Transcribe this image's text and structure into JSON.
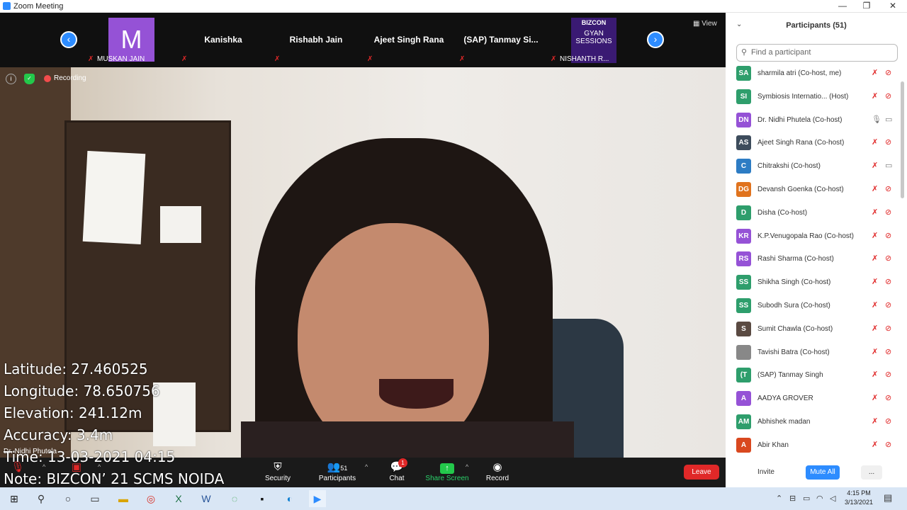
{
  "window": {
    "title": "Zoom Meeting"
  },
  "gallery": {
    "prev": "‹",
    "next": "›",
    "view": "View",
    "tiles": [
      {
        "name": "",
        "label": "MUSKAN JAIN",
        "avatar_letter": "M"
      },
      {
        "name": "Kanishka",
        "label": ""
      },
      {
        "name": "Rishabh Jain",
        "label": ""
      },
      {
        "name": "Ajeet Singh Rana",
        "label": ""
      },
      {
        "name": "(SAP) Tanmay Si...",
        "label": ""
      },
      {
        "name": "",
        "label": "NISHANTH R...",
        "bizcon_top": "BIZCON",
        "bizcon_sub": "GYAN SESSIONS"
      }
    ]
  },
  "video": {
    "recording": "Recording",
    "speaker": "Dr. Nidhi Phutela",
    "overlay": [
      "Latitude: 27.460525",
      "Longitude: 78.650756",
      "Elevation: 241.12m",
      "Accuracy: 3.4m",
      "Time: 13-03-2021  04:15",
      "Note: BIZCON’ 21 SCMS NOIDA"
    ]
  },
  "toolbar": {
    "security": "Security",
    "participants": "Participants",
    "participants_count": "51",
    "chat": "Chat",
    "chat_badge": "1",
    "share": "Share Screen",
    "record": "Record",
    "leave": "Leave"
  },
  "panel": {
    "title": "Participants (51)",
    "search_placeholder": "Find a participant",
    "invite": "Invite",
    "mute_all": "Mute All",
    "more": "...",
    "participants": [
      {
        "initials": "SA",
        "name": "sharmila atri (Co-host, me)",
        "color": "#2e9e6c",
        "mic": "off",
        "cam": "off"
      },
      {
        "initials": "SI",
        "name": "Symbiosis Internatio...  (Host)",
        "color": "#2e9e6c",
        "mic": "off",
        "cam": "off"
      },
      {
        "initials": "DN",
        "name": "Dr. Nidhi Phutela (Co-host)",
        "color": "#9552d6",
        "mic": "on",
        "cam": "on"
      },
      {
        "initials": "AS",
        "name": "Ajeet Singh Rana (Co-host)",
        "color": "#3d4c5c",
        "mic": "off",
        "cam": "off"
      },
      {
        "initials": "C",
        "name": "Chitrakshi (Co-host)",
        "color": "#2d7cc4",
        "mic": "off",
        "cam": "on"
      },
      {
        "initials": "DG",
        "name": "Devansh Goenka (Co-host)",
        "color": "#e0731e",
        "mic": "off",
        "cam": "off"
      },
      {
        "initials": "D",
        "name": "Disha (Co-host)",
        "color": "#2e9e6c",
        "mic": "off",
        "cam": "off"
      },
      {
        "initials": "KR",
        "name": "K.P.Venugopala Rao (Co-host)",
        "color": "#9552d6",
        "mic": "off",
        "cam": "off"
      },
      {
        "initials": "RS",
        "name": "Rashi Sharma (Co-host)",
        "color": "#9552d6",
        "mic": "off",
        "cam": "off"
      },
      {
        "initials": "SS",
        "name": "Shikha Singh (Co-host)",
        "color": "#2e9e6c",
        "mic": "off",
        "cam": "off"
      },
      {
        "initials": "SS",
        "name": "Subodh Sura (Co-host)",
        "color": "#2e9e6c",
        "mic": "off",
        "cam": "off"
      },
      {
        "initials": "S",
        "name": "Sumit Chawla (Co-host)",
        "color": "#5a4a42",
        "mic": "off",
        "cam": "off"
      },
      {
        "initials": "",
        "name": "Tavishi Batra (Co-host)",
        "color": "#888888",
        "mic": "off",
        "cam": "off"
      },
      {
        "initials": "(T",
        "name": "(SAP) Tanmay Singh",
        "color": "#2e9e6c",
        "mic": "off",
        "cam": "off"
      },
      {
        "initials": "A",
        "name": "AADYA GROVER",
        "color": "#9552d6",
        "mic": "off",
        "cam": "off"
      },
      {
        "initials": "AM",
        "name": "Abhishek madan",
        "color": "#2e9e6c",
        "mic": "off",
        "cam": "off"
      },
      {
        "initials": "A",
        "name": "Abir Khan",
        "color": "#d9481f",
        "mic": "off",
        "cam": "off"
      }
    ]
  },
  "taskbar": {
    "time": "4:15 PM",
    "date": "3/13/2021"
  }
}
